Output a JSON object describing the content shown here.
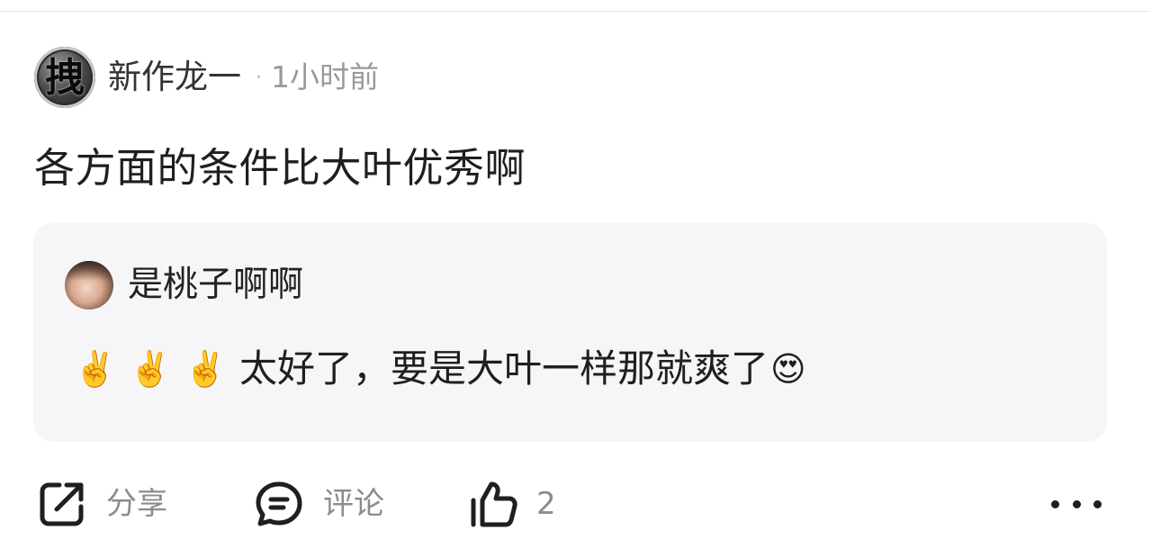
{
  "post": {
    "author": {
      "name": "新作龙一",
      "avatar_glyph": "拽",
      "separator": "·",
      "time": "1小时前"
    },
    "text": "各方面的条件比大叶优秀啊",
    "quote": {
      "author_name": "是桃子啊啊",
      "emojis_before": [
        "✌️",
        "✌️",
        "✌️"
      ],
      "text": "太好了，要是大叶一样那就爽了",
      "emoji_after": "😍"
    }
  },
  "actions": {
    "share_label": "分享",
    "comment_label": "评论",
    "like_count": "2",
    "share_icon": "share-icon",
    "comment_icon": "comment-icon",
    "like_icon": "thumbs-up-icon",
    "more_icon": "more-icon"
  },
  "colors": {
    "quote_background": "#f6f6f8",
    "secondary_text": "#9a9a9a",
    "primary_text": "#1f1f1f"
  }
}
